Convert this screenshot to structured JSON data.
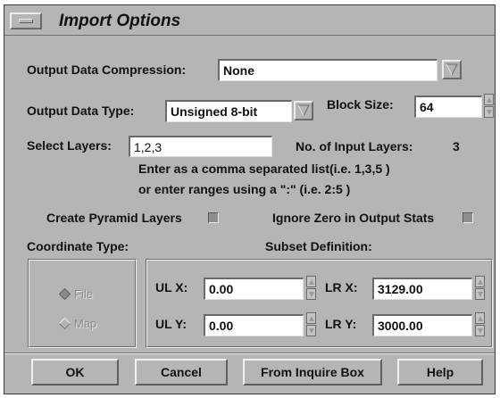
{
  "window": {
    "title": "Import Options",
    "colors": {
      "background": "#b5b5b5",
      "field": "#ffffff",
      "text": "#111111",
      "disabled_text": "#8a8a8a"
    }
  },
  "output_compression": {
    "label": "Output Data Compression:",
    "value": "None"
  },
  "output_type": {
    "label": "Output Data Type:",
    "value": "Unsigned 8-bit"
  },
  "block_size": {
    "label": "Block Size:",
    "value": "64"
  },
  "select_layers": {
    "label": "Select Layers:",
    "value": "1,2,3"
  },
  "input_layers": {
    "label": "No. of Input Layers:",
    "value": "3"
  },
  "hint": {
    "line1": "Enter as a comma separated list(i.e. 1,3,5 )",
    "line2": "or enter ranges using a \":\" (i.e. 2:5 )"
  },
  "pyramid": {
    "label": "Create Pyramid Layers"
  },
  "ignore_zero": {
    "label": "Ignore Zero in Output Stats"
  },
  "coordinate_type": {
    "label": "Coordinate Type:",
    "options": [
      {
        "label": "File",
        "selected": true
      },
      {
        "label": "Map",
        "selected": false
      }
    ]
  },
  "subset": {
    "label": "Subset Definition:",
    "ul_x": {
      "label": "UL X:",
      "value": "0.00"
    },
    "ul_y": {
      "label": "UL Y:",
      "value": "0.00"
    },
    "lr_x": {
      "label": "LR X:",
      "value": "3129.00"
    },
    "lr_y": {
      "label": "LR Y:",
      "value": "3000.00"
    }
  },
  "buttons": {
    "ok": "OK",
    "cancel": "Cancel",
    "inquire": "From Inquire Box",
    "help": "Help"
  }
}
